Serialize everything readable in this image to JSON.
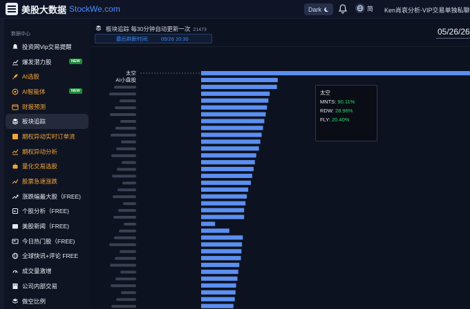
{
  "header": {
    "logo_text": "美股大数据",
    "logo_url": "StockWe.com",
    "theme_label": "Dark",
    "lang_label": "简",
    "promo": "Ken肖哀分析-VIP交易单独私聊"
  },
  "sidebar": {
    "section_title": "数据中心",
    "items": [
      {
        "label": "投资网Vip交易提醒",
        "icon": "bell-icon",
        "orange": false
      },
      {
        "label": "爆发潜力股",
        "icon": "chart-up-icon",
        "orange": false,
        "badge": "NEW"
      },
      {
        "label": "AI选股",
        "icon": "rocket-icon",
        "orange": true
      },
      {
        "label": "AI智能体",
        "icon": "target-icon",
        "orange": true,
        "badge": "NEW"
      },
      {
        "label": "财报预测",
        "icon": "calendar-icon",
        "orange": true
      },
      {
        "label": "板块追踪",
        "icon": "layers-icon",
        "orange": false,
        "active": true
      },
      {
        "label": "期权异动实时订单流",
        "icon": "options-icon",
        "orange": true
      },
      {
        "label": "期权异动分析",
        "icon": "line-chart-icon",
        "orange": true
      },
      {
        "label": "量化交易选股",
        "icon": "robot-icon",
        "orange": true
      },
      {
        "label": "股票急速涨跌",
        "icon": "spark-icon",
        "orange": true
      },
      {
        "label": "涨跌幅最大股（FREE)",
        "icon": "trend-icon",
        "orange": false
      },
      {
        "label": "个股分析（FREE)",
        "icon": "search-icon",
        "orange": false
      },
      {
        "label": "美股新闻（FREE)",
        "icon": "news-icon",
        "orange": false
      },
      {
        "label": "今日热门股（FREE)",
        "icon": "hot-icon",
        "orange": false
      },
      {
        "label": "全球快讯+评论 FREE",
        "icon": "globe-icon",
        "orange": false
      },
      {
        "label": "成交量激增",
        "icon": "volume-icon",
        "orange": false
      },
      {
        "label": "公司内部交易",
        "icon": "building-icon",
        "orange": false
      },
      {
        "label": "做空比例",
        "icon": "short-icon",
        "orange": false
      }
    ]
  },
  "main": {
    "title": "板块追踪 每30分钟自动更新一次",
    "count": "21473",
    "updated_label": "最后刷新时间:",
    "updated_value": "05/26 10:30",
    "date": "05/26/26"
  },
  "tooltip": {
    "title": "太空",
    "rows": [
      {
        "ticker": "MNTS:",
        "value": "90.11%"
      },
      {
        "ticker": "RDW:",
        "value": "28.96%"
      },
      {
        "ticker": "FLY:",
        "value": "20.40%"
      }
    ]
  },
  "chart_data": {
    "type": "bar",
    "orientation": "horizontal",
    "categories": [
      "太空",
      "AI小盘股"
    ],
    "values": [
      100,
      28.5,
      28.2,
      25.5,
      25.0,
      24.5,
      24.0,
      23.5,
      23.0,
      22.5,
      22.0,
      21.5,
      20.5,
      20.0,
      19.5,
      19.0,
      18.5,
      17.5,
      17.0,
      16.5,
      16.0,
      16.0,
      5.2,
      10.5,
      15.5,
      15.2,
      15.0,
      14.8,
      14.2,
      13.8,
      13.5,
      13.0,
      12.8,
      12.5,
      12.0,
      11.8,
      11.5
    ],
    "color": "#5b8ff0",
    "highlight_color": "#6c9cf5"
  }
}
